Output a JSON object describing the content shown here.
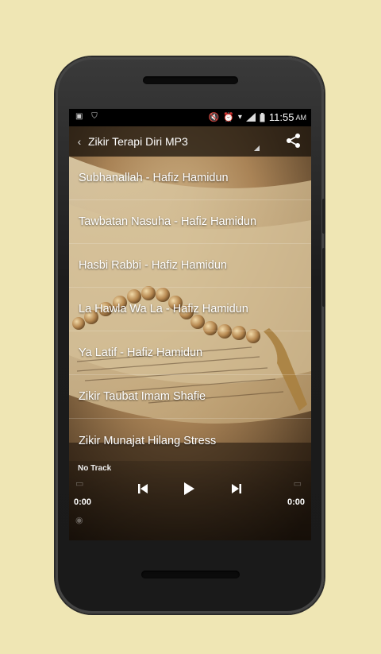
{
  "status_bar": {
    "left_icons": [
      "image-icon",
      "shield-icon"
    ],
    "right_icons": [
      "mute-icon",
      "alarm-icon",
      "wifi-icon",
      "signal-icon",
      "battery-icon"
    ],
    "time": "11:55",
    "time_suffix": "AM"
  },
  "action_bar": {
    "back_icon": "chevron-left-icon",
    "title": "Zikir Terapi Diri MP3",
    "share_icon": "share-icon"
  },
  "playlist": [
    {
      "label": "Subhanallah - Hafiz Hamidun"
    },
    {
      "label": "Tawbatan Nasuha - Hafiz Hamidun"
    },
    {
      "label": "Hasbi Rabbi - Hafiz Hamidun"
    },
    {
      "label": "La Hawla Wa La - Hafiz Hamidun"
    },
    {
      "label": "Ya Latif - Hafiz Hamidun"
    },
    {
      "label": "Zikir Taubat Imam Shafie"
    },
    {
      "label": "Zikir Munajat Hilang Stress"
    }
  ],
  "player": {
    "track_name": "No Track",
    "elapsed": "0:00",
    "duration": "0:00",
    "prev_icon": "skip-previous-icon",
    "play_icon": "play-icon",
    "next_icon": "skip-next-icon"
  }
}
